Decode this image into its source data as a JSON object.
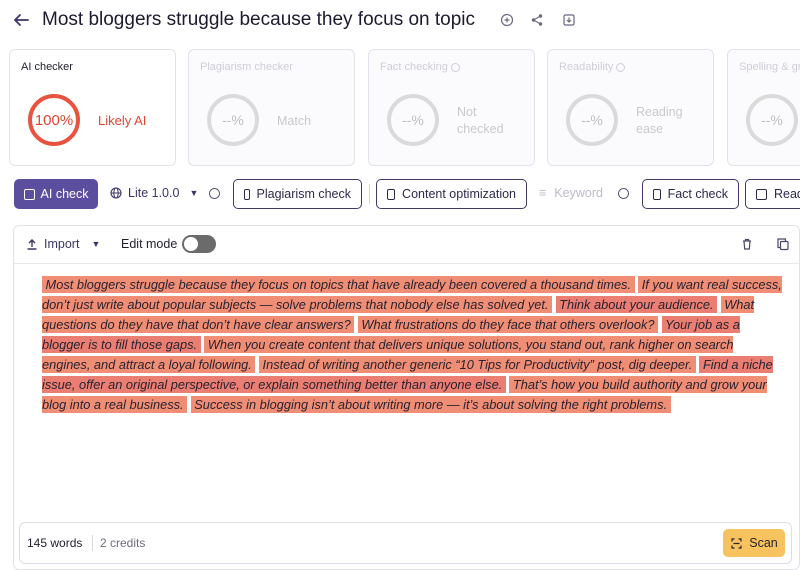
{
  "header": {
    "title": "Most bloggers struggle because they focus on topic",
    "icons": [
      "back-arrow-icon",
      "add-circle-icon",
      "share-icon",
      "download-icon"
    ]
  },
  "cards": [
    {
      "label": "AI checker",
      "ring": "100%",
      "status": "Likely AI",
      "active": true,
      "color": "#e2452f"
    },
    {
      "label": "Plagiarism checker",
      "ring": "--%",
      "status": "Match",
      "active": false
    },
    {
      "label": "Fact checking",
      "ring": "--%",
      "status": "Not checked",
      "active": false
    },
    {
      "label": "Readability",
      "ring": "--%",
      "status": "Reading ease",
      "active": false
    },
    {
      "label": "Spelling & gr",
      "ring": "--%",
      "status": "",
      "active": false
    }
  ],
  "toolbar": {
    "ai_check": "AI check",
    "model": "Lite 1.0.0",
    "plagiarism": "Plagiarism check",
    "content_opt": "Content optimization",
    "keyword": "Keyword",
    "fact_check": "Fact check",
    "read": "Read"
  },
  "editor": {
    "import": "Import",
    "edit_mode": "Edit mode",
    "edit_mode_on": false,
    "sentences": [
      "Most bloggers struggle because they focus on topics that have already been covered a thousand times.",
      "If you want real success, don’t just write about popular subjects — solve problems that nobody else has solved yet.",
      "Think about your audience.",
      "What questions do they have that don’t have clear answers?",
      "What frustrations do they face that others overlook?",
      "Your job as a blogger is to fill those gaps.",
      "When you create content that delivers unique solutions, you stand out, rank higher on search engines, and attract a loyal following.",
      "Instead of writing another generic “10 Tips for Productivity” post, dig deeper.",
      "Find a niche issue, offer an original perspective, or explain something better than anyone else.",
      "That’s how you build authority and grow your blog into a real business.",
      "Success in blogging isn’t about writing more — it’s about solving the right problems."
    ],
    "highlight_colors": [
      "#ef8e74",
      "#ea7e72"
    ],
    "word_count": "145 words",
    "credits": "2 credits",
    "scan": "Scan"
  },
  "accent": {
    "primary": "#5b4e9f",
    "scan": "#f7c35e",
    "ai_red": "#e2452f"
  }
}
